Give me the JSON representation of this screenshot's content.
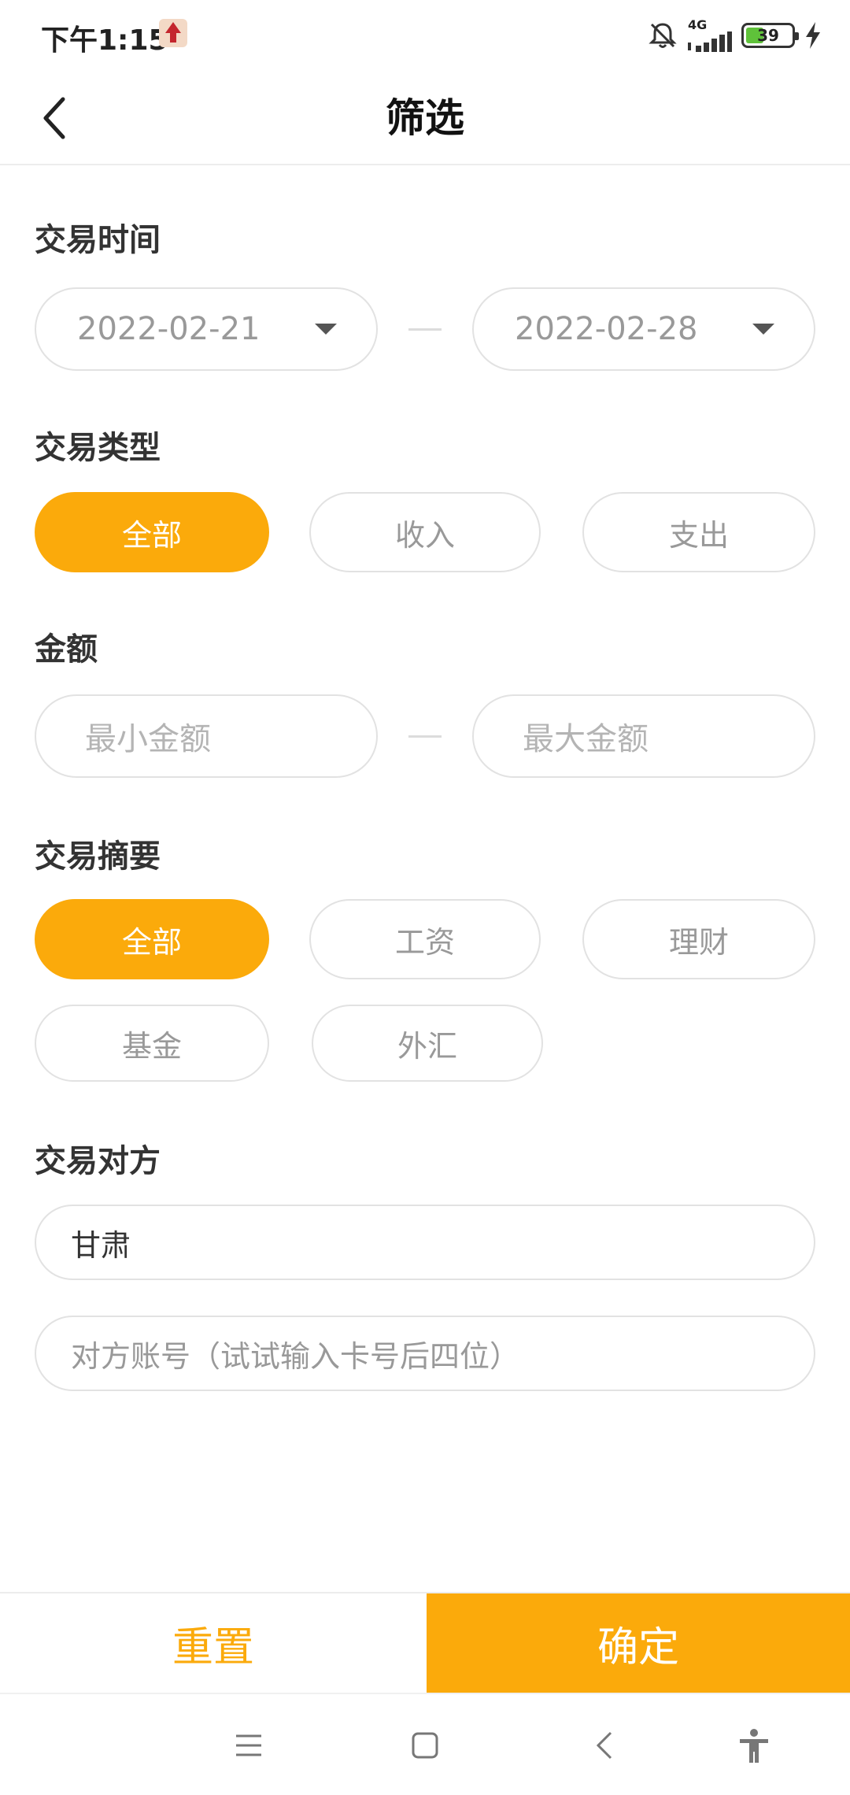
{
  "status_bar": {
    "time": "下午1:15",
    "network": "4G",
    "battery": "39"
  },
  "header": {
    "title": "筛选"
  },
  "transaction_time": {
    "label": "交易时间",
    "start_date": "2022-02-21",
    "end_date": "2022-02-28"
  },
  "transaction_type": {
    "label": "交易类型",
    "options": [
      "全部",
      "收入",
      "支出"
    ],
    "selected": "全部"
  },
  "amount": {
    "label": "金额",
    "min_placeholder": "最小金额",
    "max_placeholder": "最大金额"
  },
  "summary": {
    "label": "交易摘要",
    "options": [
      "全部",
      "工资",
      "理财",
      "基金",
      "外汇"
    ],
    "selected": "全部"
  },
  "counterparty": {
    "label": "交易对方",
    "name_value": "甘肃",
    "account_placeholder": "对方账号（试试输入卡号后四位）"
  },
  "footer": {
    "reset_label": "重置",
    "confirm_label": "确定"
  },
  "colors": {
    "accent": "#fbaa0b",
    "border": "#e2e2e2",
    "muted_text": "#999999"
  },
  "icons": {
    "back": "chevron-left-icon",
    "dropdown": "caret-down-icon",
    "nav_menu": "menu-icon",
    "nav_home": "home-square-icon",
    "nav_back": "nav-back-icon",
    "nav_accessibility": "accessibility-icon"
  }
}
